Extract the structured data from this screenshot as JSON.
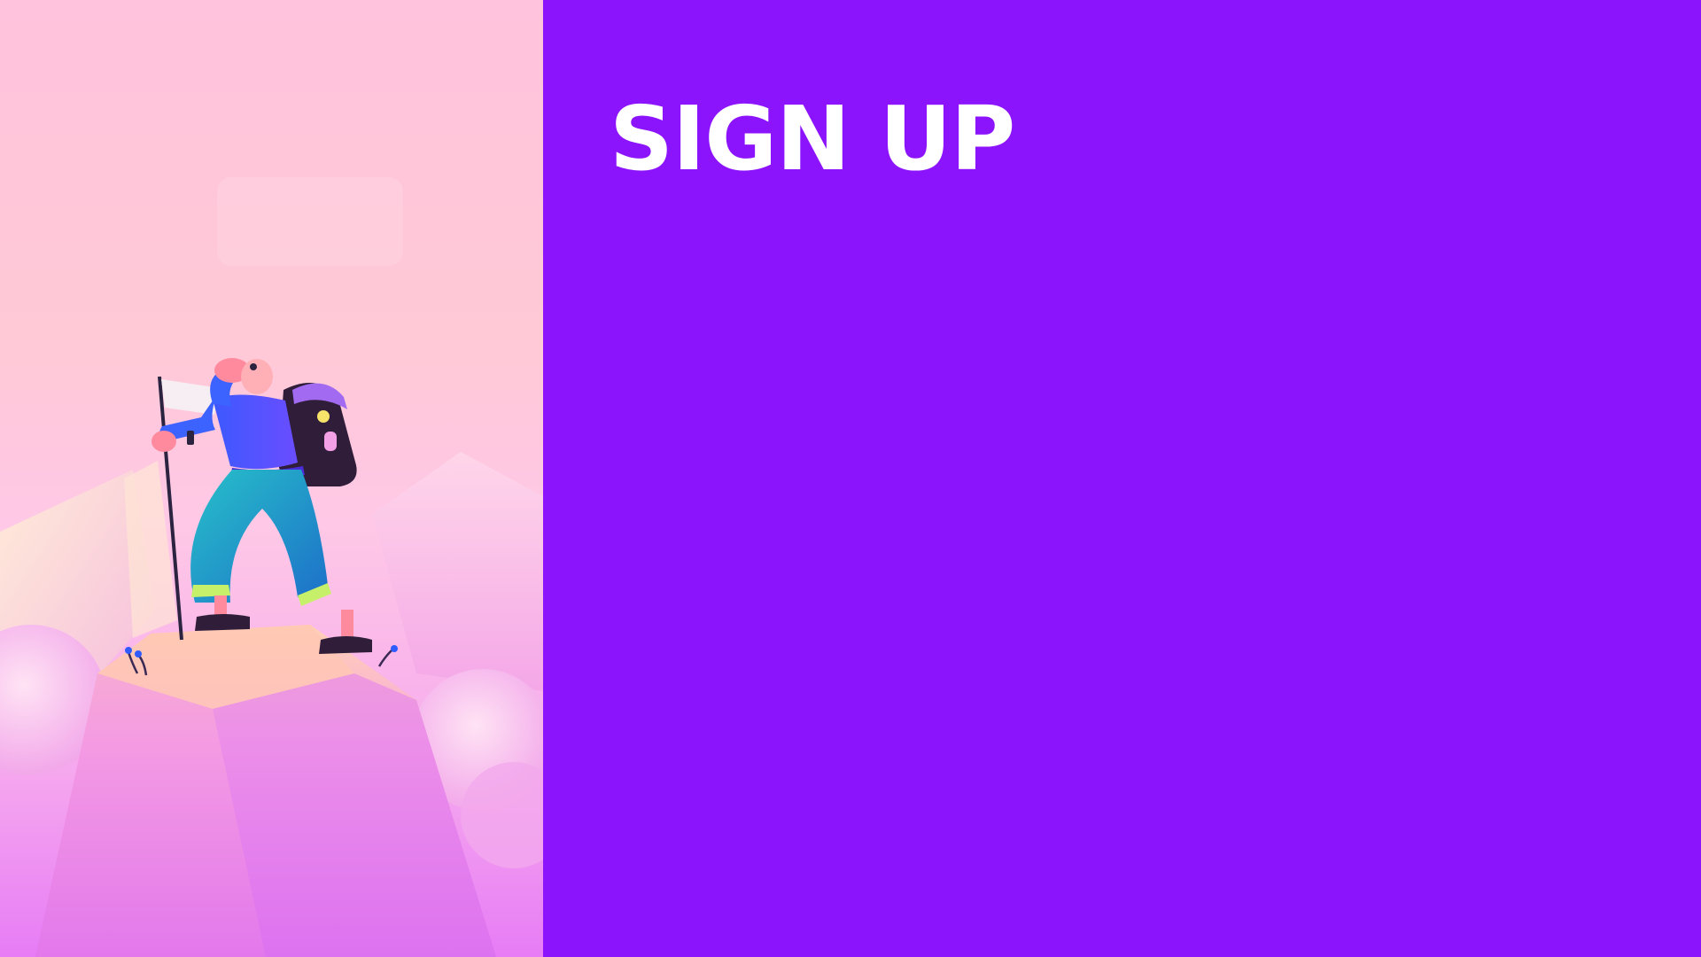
{
  "signup_panel": {
    "title": "SIGN UP",
    "background_color": "#8C14FC"
  },
  "hero": {
    "illustration": "hiker-on-mountain-peak-with-flag",
    "sky_colors": [
      "#FFC3DD",
      "#FFC8E6",
      "#E77CF6"
    ]
  }
}
